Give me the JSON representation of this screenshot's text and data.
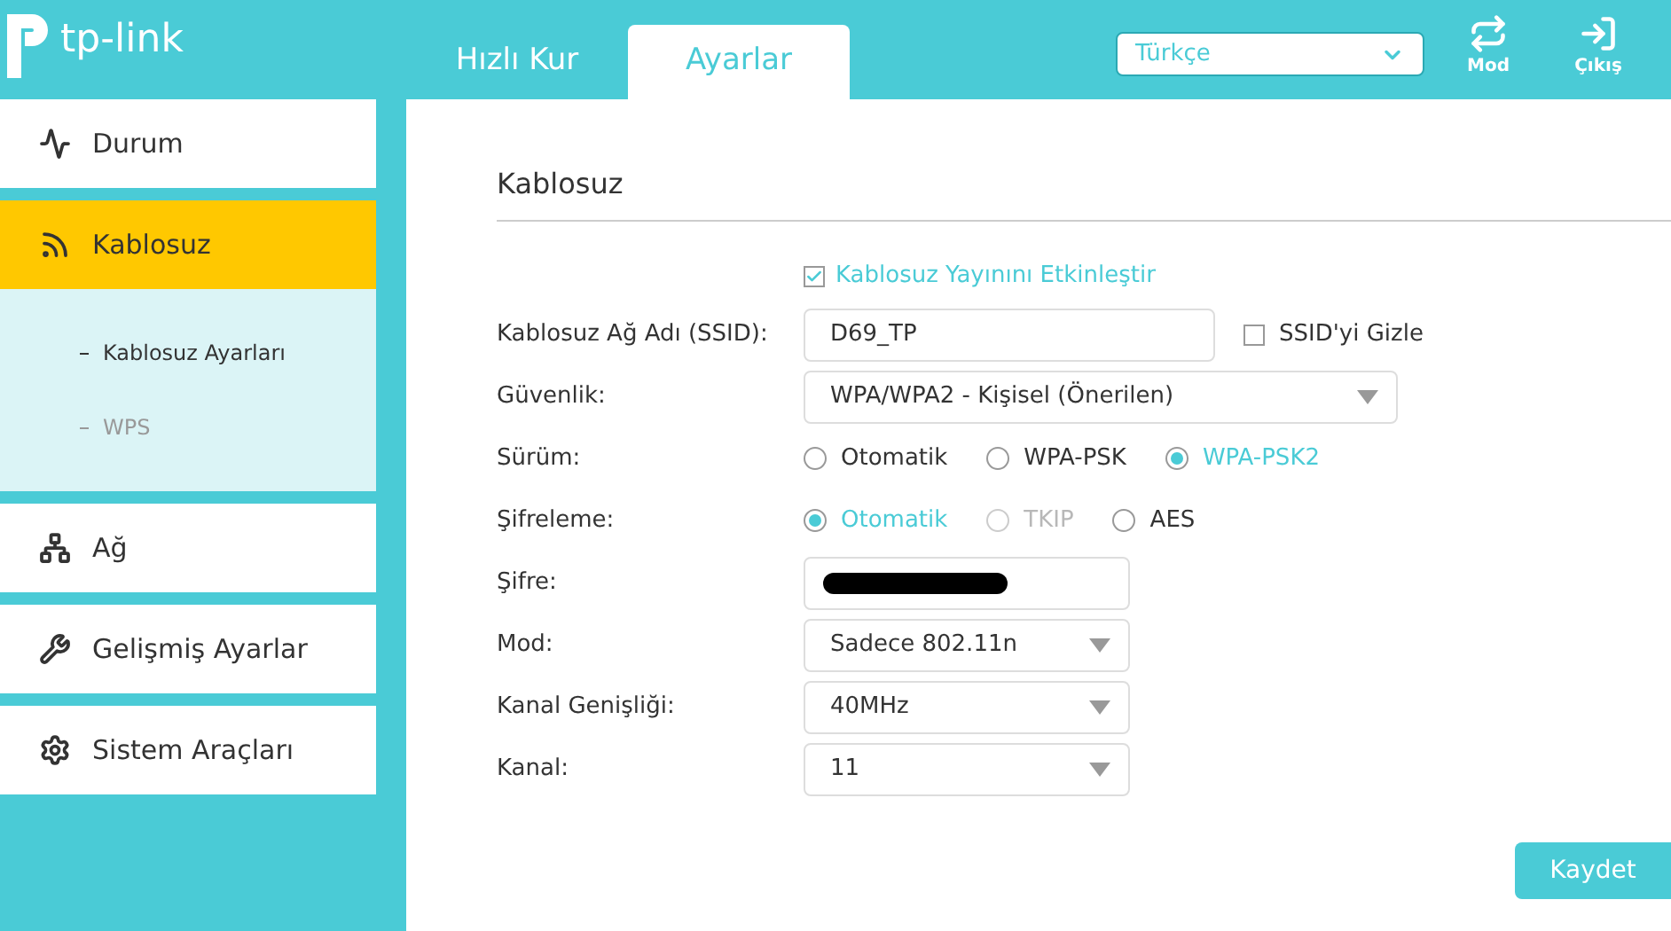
{
  "header": {
    "logo_text": "tp-link",
    "tabs": [
      {
        "label": "Hızlı Kur",
        "selected": false
      },
      {
        "label": "Ayarlar",
        "selected": true
      }
    ],
    "language": {
      "value": "Türkçe"
    },
    "actions": [
      {
        "kind": "mode",
        "label": "Mod"
      },
      {
        "kind": "logout",
        "label": "Çıkış"
      }
    ]
  },
  "sidebar": {
    "items": [
      {
        "label": "Durum",
        "selected": false
      },
      {
        "label": "Kablosuz",
        "selected": true,
        "children": [
          {
            "label": "Kablosuz Ayarları",
            "selected": true
          },
          {
            "label": "WPS",
            "selected": false
          }
        ]
      },
      {
        "label": "Ağ",
        "selected": false
      },
      {
        "label": "Gelişmiş Ayarlar",
        "selected": false
      },
      {
        "label": "Sistem Araçları",
        "selected": false
      }
    ]
  },
  "content": {
    "title": "Kablosuz",
    "enable": {
      "label": "Kablosuz Yayınını Etkinleştir",
      "checked": true
    },
    "rows": [
      {
        "kind": "text",
        "label": "Kablosuz Ağ Adı (SSID):",
        "value": "D69_TP",
        "extra": {
          "label": "SSID'yi Gizle",
          "checked": false
        }
      },
      {
        "kind": "select",
        "label": "Güvenlik:",
        "value": "WPA/WPA2 - Kişisel (Önerilen)",
        "wide": true
      },
      {
        "kind": "radio",
        "label": "Sürüm:",
        "options": [
          {
            "label": "Otomatik",
            "selected": false,
            "disabled": false
          },
          {
            "label": "WPA-PSK",
            "selected": false,
            "disabled": false
          },
          {
            "label": "WPA-PSK2",
            "selected": true,
            "disabled": false
          }
        ]
      },
      {
        "kind": "radio",
        "label": "Şifreleme:",
        "options": [
          {
            "label": "Otomatik",
            "selected": true,
            "disabled": false
          },
          {
            "label": "TKIP",
            "selected": false,
            "disabled": true
          },
          {
            "label": "AES",
            "selected": false,
            "disabled": false
          }
        ]
      },
      {
        "kind": "password",
        "label": "Şifre:",
        "redacted": true
      },
      {
        "kind": "select",
        "label": "Mod:",
        "value": "Sadece 802.11n",
        "wide": false
      },
      {
        "kind": "select",
        "label": "Kanal Genişliği:",
        "value": "40MHz",
        "wide": false
      },
      {
        "kind": "select",
        "label": "Kanal:",
        "value": "11",
        "wide": false
      }
    ]
  },
  "save_button": "Kaydet"
}
